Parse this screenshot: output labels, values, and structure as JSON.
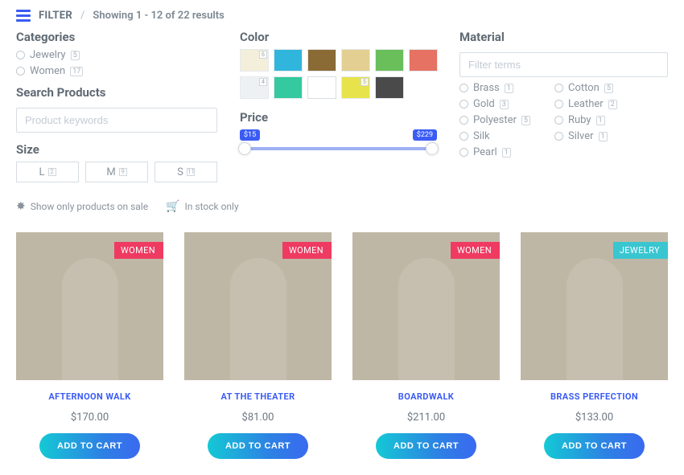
{
  "header": {
    "filter_label": "FILTER",
    "results_text": "Showing 1 - 12 of 22 results"
  },
  "categories": {
    "title": "Categories",
    "items": [
      {
        "label": "Jewelry",
        "count": "5"
      },
      {
        "label": "Women",
        "count": "17"
      }
    ]
  },
  "search": {
    "title": "Search Products",
    "placeholder": "Product keywords"
  },
  "size": {
    "title": "Size",
    "items": [
      {
        "label": "L",
        "count": "2"
      },
      {
        "label": "M",
        "count": "9"
      },
      {
        "label": "S",
        "count": "11"
      }
    ]
  },
  "color": {
    "title": "Color",
    "swatches": [
      {
        "hex": "#f4efdb",
        "count": "6"
      },
      {
        "hex": "#30b6dd",
        "count": ""
      },
      {
        "hex": "#8a6a35",
        "count": ""
      },
      {
        "hex": "#e3cf91",
        "count": ""
      },
      {
        "hex": "#6abf5b",
        "count": ""
      },
      {
        "hex": "#e67263",
        "count": ""
      },
      {
        "hex": "#eef1f4",
        "count": "4"
      },
      {
        "hex": "#35c9a0",
        "count": ""
      },
      {
        "hex": "#ffffff",
        "count": ""
      },
      {
        "hex": "#e7e34a",
        "count": "5"
      },
      {
        "hex": "#4a4a4a",
        "count": ""
      }
    ]
  },
  "price": {
    "title": "Price",
    "min_label": "$15",
    "max_label": "$229"
  },
  "material": {
    "title": "Material",
    "placeholder": "Filter terms",
    "left": [
      {
        "label": "Brass",
        "count": "1"
      },
      {
        "label": "Gold",
        "count": "3"
      },
      {
        "label": "Polyester",
        "count": "5"
      },
      {
        "label": "Silk",
        "count": ""
      },
      {
        "label": "Pearl",
        "count": "1"
      }
    ],
    "right": [
      {
        "label": "Cotton",
        "count": "5"
      },
      {
        "label": "Leather",
        "count": "2"
      },
      {
        "label": "Ruby",
        "count": "1"
      },
      {
        "label": "Silver",
        "count": "1"
      }
    ]
  },
  "flags": {
    "sale": "Show only products on sale",
    "stock": "In stock only"
  },
  "products": [
    {
      "name": "AFTERNOON WALK",
      "price": "$170.00",
      "tag": "WOMEN",
      "tag_class": "",
      "btn": "ADD TO CART"
    },
    {
      "name": "AT THE THEATER",
      "price": "$81.00",
      "tag": "WOMEN",
      "tag_class": "",
      "btn": "ADD TO CART"
    },
    {
      "name": "BOARDWALK",
      "price": "$211.00",
      "tag": "WOMEN",
      "tag_class": "",
      "btn": "ADD TO CART"
    },
    {
      "name": "BRASS PERFECTION",
      "price": "$133.00",
      "tag": "JEWELRY",
      "tag_class": "jewelry",
      "btn": "ADD TO CART"
    }
  ]
}
